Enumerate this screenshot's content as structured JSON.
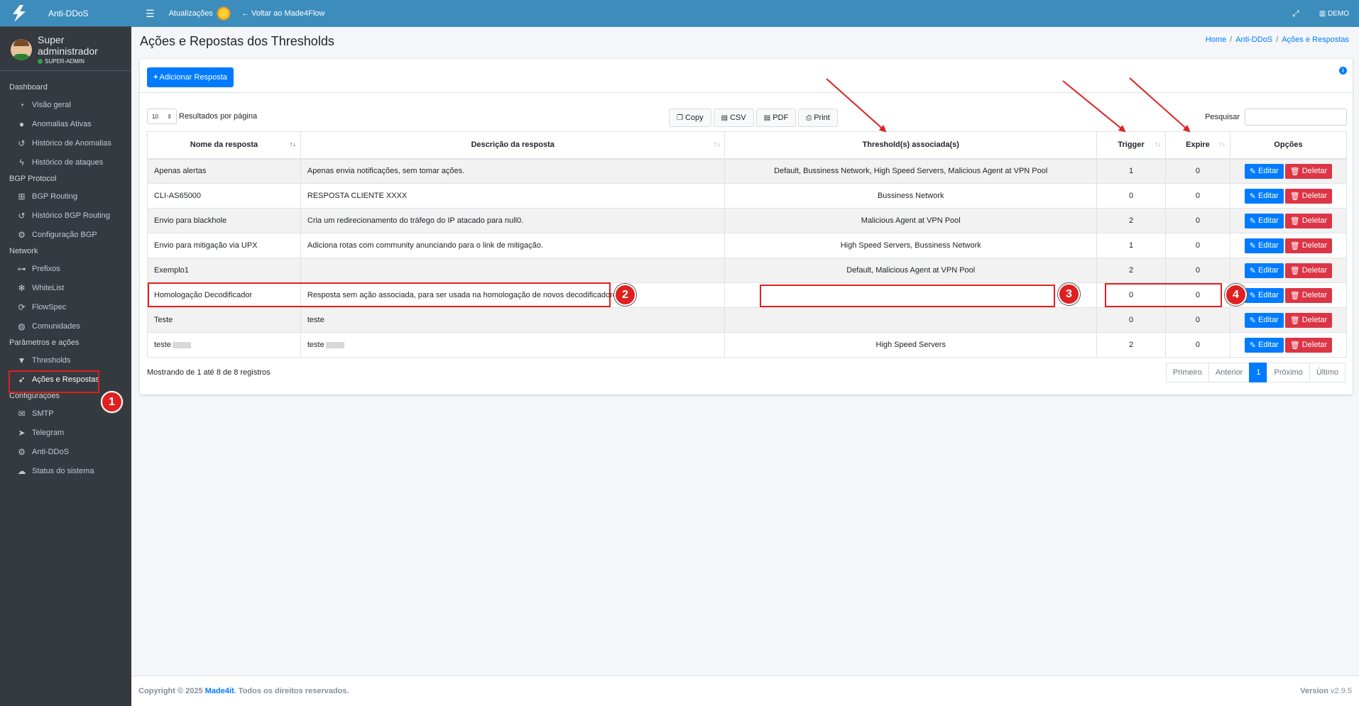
{
  "brand": {
    "name": "Anti-DDoS"
  },
  "user": {
    "name": "Super administrador",
    "role": "SUPER-ADMIN"
  },
  "sidebar": {
    "sections": [
      {
        "header": "Dashboard",
        "items": [
          {
            "label": "Visão geral",
            "icon": "dashboard-icon"
          },
          {
            "label": "Anomalias Ativas",
            "icon": "exclamation-icon"
          },
          {
            "label": "Histórico de Anomalias",
            "icon": "history-icon"
          },
          {
            "label": "Histórico de ataques",
            "icon": "bolt-icon"
          }
        ]
      },
      {
        "header": "BGP Protocol",
        "items": [
          {
            "label": "BGP Routing",
            "icon": "sitemap-icon"
          },
          {
            "label": "Histórico BGP Routing",
            "icon": "history-icon"
          },
          {
            "label": "Configuração BGP",
            "icon": "gear-icon"
          }
        ]
      },
      {
        "header": "Network",
        "items": [
          {
            "label": "Prefixos",
            "icon": "network-icon"
          },
          {
            "label": "WhiteList",
            "icon": "gear-outline-icon"
          },
          {
            "label": "FlowSpec",
            "icon": "sync-icon"
          },
          {
            "label": "Comunidades",
            "icon": "globe-icon"
          }
        ]
      },
      {
        "header": "Parâmetros e ações",
        "items": [
          {
            "label": "Thresholds",
            "icon": "filter-icon"
          },
          {
            "label": "Ações e Respostas",
            "icon": "rocket-icon"
          }
        ]
      },
      {
        "header": "Configurações",
        "items": [
          {
            "label": "SMTP",
            "icon": "mail-server-icon"
          },
          {
            "label": "Telegram",
            "icon": "telegram-icon"
          },
          {
            "label": "Anti-DDoS",
            "icon": "gears-icon"
          },
          {
            "label": "Status do sistema",
            "icon": "cloud-icon"
          }
        ]
      }
    ]
  },
  "topbar": {
    "updates": "Atualizações",
    "back": "Voltar ao Made4Flow",
    "account": "DEMO"
  },
  "page": {
    "title": "Ações e Repostas dos Thresholds"
  },
  "breadcrumb": [
    "Home",
    "Anti-DDoS",
    "Ações e Respostas"
  ],
  "card": {
    "add_button": "Adicionar Resposta",
    "length_value": "10",
    "length_label": "Resultados por página",
    "export_buttons": [
      "Copy",
      "CSV",
      "PDF",
      "Print"
    ],
    "search_label": "Pesquisar",
    "search_value": ""
  },
  "table": {
    "columns": [
      "Nome da resposta",
      "Descrição da resposta",
      "Threshold(s) associada(s)",
      "Trigger",
      "Expire",
      "Opções"
    ],
    "rows": [
      {
        "name": "Apenas alertas",
        "desc": "Apenas envia notificações, sem tomar ações.",
        "thresholds": "Default, Bussiness Network, High Speed Servers, Malicious Agent at VPN Pool",
        "trigger": "1",
        "expire": "0"
      },
      {
        "name": "CLI-AS65000",
        "desc": "RESPOSTA CLIENTE XXXX",
        "thresholds": "Bussiness Network",
        "trigger": "0",
        "expire": "0"
      },
      {
        "name": "Envio para blackhole",
        "desc": "Cria um redirecionamento do tráfego do IP atacado para null0.",
        "thresholds": "Malicious Agent at VPN Pool",
        "trigger": "2",
        "expire": "0"
      },
      {
        "name": "Envio para mitigação via UPX",
        "desc": "Adiciona rotas com community anunciando para o link de mitigação.",
        "thresholds": "High Speed Servers, Bussiness Network",
        "trigger": "1",
        "expire": "0"
      },
      {
        "name": "Exemplo1",
        "desc": "",
        "thresholds": "Default, Malicious Agent at VPN Pool",
        "trigger": "2",
        "expire": "0"
      },
      {
        "name": "Homologação Decodificador",
        "desc": "Resposta sem ação associada, para ser usada na homologação de novos decodificadores",
        "thresholds": "",
        "trigger": "0",
        "expire": "0"
      },
      {
        "name": "Teste",
        "desc": "teste",
        "thresholds": "",
        "trigger": "0",
        "expire": "0"
      },
      {
        "name": "teste",
        "desc": "teste",
        "thresholds": "High Speed Servers",
        "trigger": "2",
        "expire": "0"
      }
    ],
    "edit_label": "Editar",
    "delete_label": "Deletar"
  },
  "info_text": "Mostrando de 1 até 8 de 8 registros",
  "pagination": [
    "Primeiro",
    "Anterior",
    "1",
    "Próximo",
    "Último"
  ],
  "annotations": [
    "1",
    "2",
    "3",
    "4"
  ],
  "footer": {
    "copyright": "Copyright © 2025",
    "company": "Made4it",
    "rights": ". Todos os direitos reservados.",
    "version_label": "Version",
    "version": "v2.9.5"
  },
  "colors": {
    "accent": "#3c8dbc",
    "primary": "#007bff",
    "danger": "#dc3545",
    "annotation": "#e02020"
  }
}
